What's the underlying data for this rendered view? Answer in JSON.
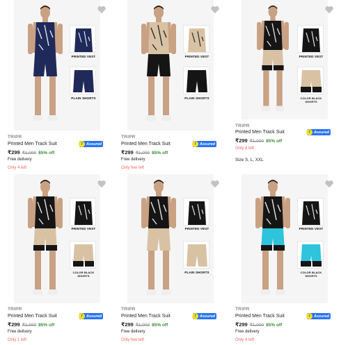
{
  "colors": {
    "accent_blue": "#2874f0",
    "discount_green": "#388e3c",
    "stock_red": "#ff6161",
    "muted_grey": "#878787",
    "assured_yellow": "#ffe11b"
  },
  "products": [
    {
      "brand": "TRIPR",
      "title": "Printed Men Track Suit",
      "price": "₹299",
      "mrp": "₹1,000",
      "discount": "85% off",
      "assured": "Assured",
      "delivery": "Free delivery",
      "stock": "Only 4 left",
      "size": "",
      "inset_top_label": "PRINTED VEST",
      "inset_bottom_label": "PLAIN SHORTS",
      "icons": [
        "wishlist-heart-icon",
        "assured-badge-icon"
      ]
    },
    {
      "brand": "TRIPR",
      "title": "Printed Men Track Suit",
      "price": "₹299",
      "mrp": "₹1,000",
      "discount": "85% off",
      "assured": "Assured",
      "delivery": "Free delivery",
      "stock": "Only few left",
      "size": "",
      "inset_top_label": "PRINTED VEST",
      "inset_bottom_label": "PLAIN SHORTS",
      "icons": [
        "wishlist-heart-icon",
        "assured-badge-icon"
      ]
    },
    {
      "brand": "TRIPR",
      "title": "Printed Men Track Suit",
      "price": "₹299",
      "mrp": "₹1,000",
      "discount": "85% off",
      "assured": "Assured",
      "delivery": "",
      "stock": "Only 4 left",
      "size": "Size S, L, XXL",
      "inset_top_label": "PRINTED VEST",
      "inset_bottom_label": "COLOR BLACK SHORTS",
      "icons": [
        "wishlist-heart-icon",
        "assured-badge-icon"
      ]
    },
    {
      "brand": "TRIPR",
      "title": "Printed Men Track Suit",
      "price": "₹299",
      "mrp": "₹1,000",
      "discount": "85% off",
      "assured": "Assured",
      "delivery": "Free delivery",
      "stock": "Only 1 left",
      "size": "",
      "inset_top_label": "PRINTED VEST",
      "inset_bottom_label": "COLOR BLACK SHORTS",
      "icons": [
        "wishlist-heart-icon",
        "assured-badge-icon"
      ]
    },
    {
      "brand": "TRIPR",
      "title": "Printed Men Track Suit",
      "price": "₹299",
      "mrp": "₹1,000",
      "discount": "85% off",
      "assured": "Assured",
      "delivery": "Free delivery",
      "stock": "Only few left",
      "size": "",
      "inset_top_label": "PRINTED VEST",
      "inset_bottom_label": "PLAIN SHORTS",
      "icons": [
        "wishlist-heart-icon",
        "assured-badge-icon"
      ]
    },
    {
      "brand": "TRIPR",
      "title": "Printed Men Track Suit",
      "price": "₹299",
      "mrp": "₹1,000",
      "discount": "85% off",
      "assured": "Assured",
      "delivery": "Free delivery",
      "stock": "Only 4 left",
      "size": "",
      "inset_top_label": "PRINTED VEST",
      "inset_bottom_label": "COLOR BLACK SHORTS",
      "icons": [
        "wishlist-heart-icon",
        "assured-badge-icon"
      ]
    }
  ]
}
